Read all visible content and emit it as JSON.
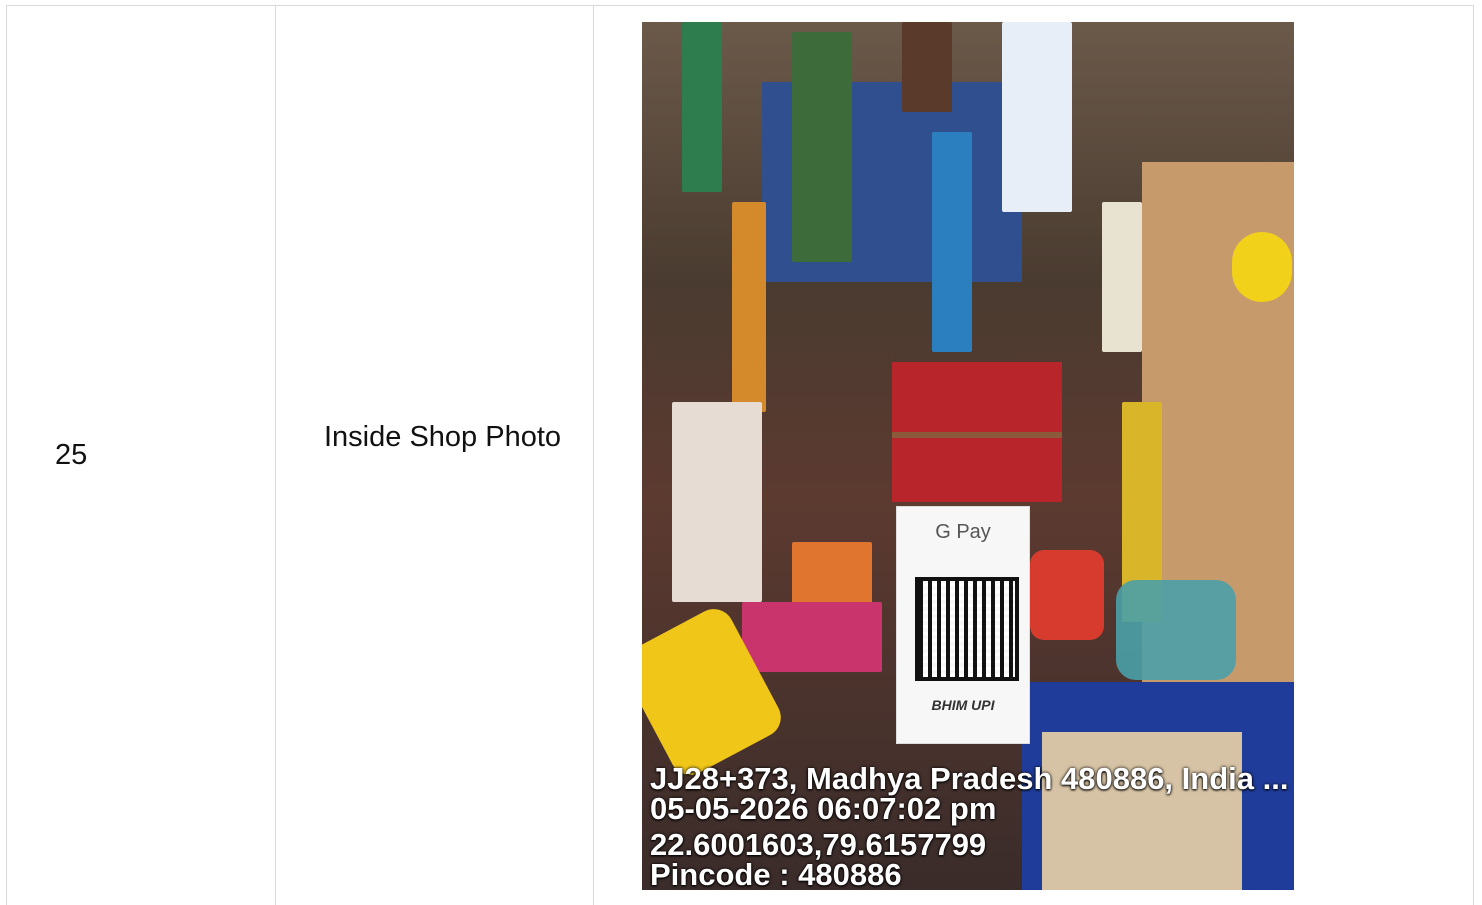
{
  "row": {
    "serial": "25",
    "label": "Inside Shop Photo"
  },
  "photo": {
    "qr_brand": "G Pay",
    "qr_footer": "BHIM UPI",
    "stamp": {
      "address": "JJ28+373, Madhya Pradesh 480886, India ...",
      "datetime": "05-05-2026 06:07:02 pm",
      "coordinates": "22.6001603,79.6157799",
      "pincode": "Pincode : 480886"
    }
  }
}
